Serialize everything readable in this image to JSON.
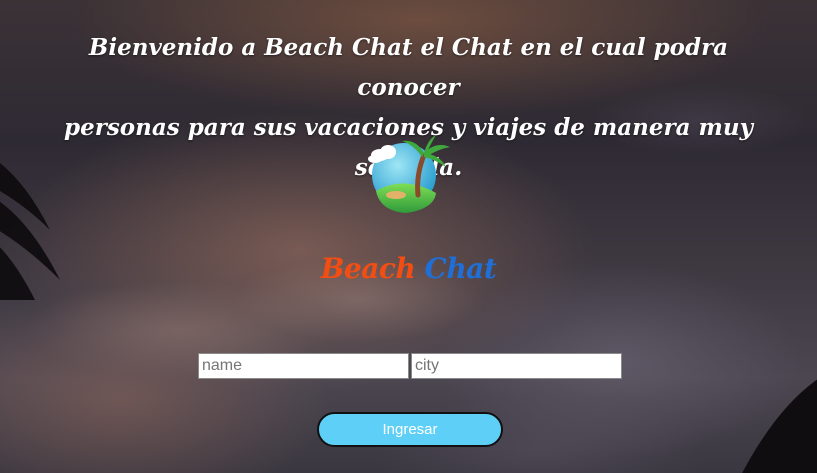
{
  "welcome": {
    "line1": "Bienvenido a Beach Chat el Chat en el cual podra conocer",
    "line2": "personas para sus vacaciones y viajes de manera muy sencilla."
  },
  "logo": {
    "icon": "island-palm-icon"
  },
  "brand": {
    "part1": "Beach",
    "part2": "Chat",
    "colors": {
      "beach": "#f24d12",
      "chat": "#1f6fd6"
    }
  },
  "form": {
    "name_placeholder": "name",
    "name_value": "",
    "city_placeholder": "city",
    "city_value": "",
    "submit_label": "Ingresar",
    "submit_color": "#5ed0f7"
  }
}
